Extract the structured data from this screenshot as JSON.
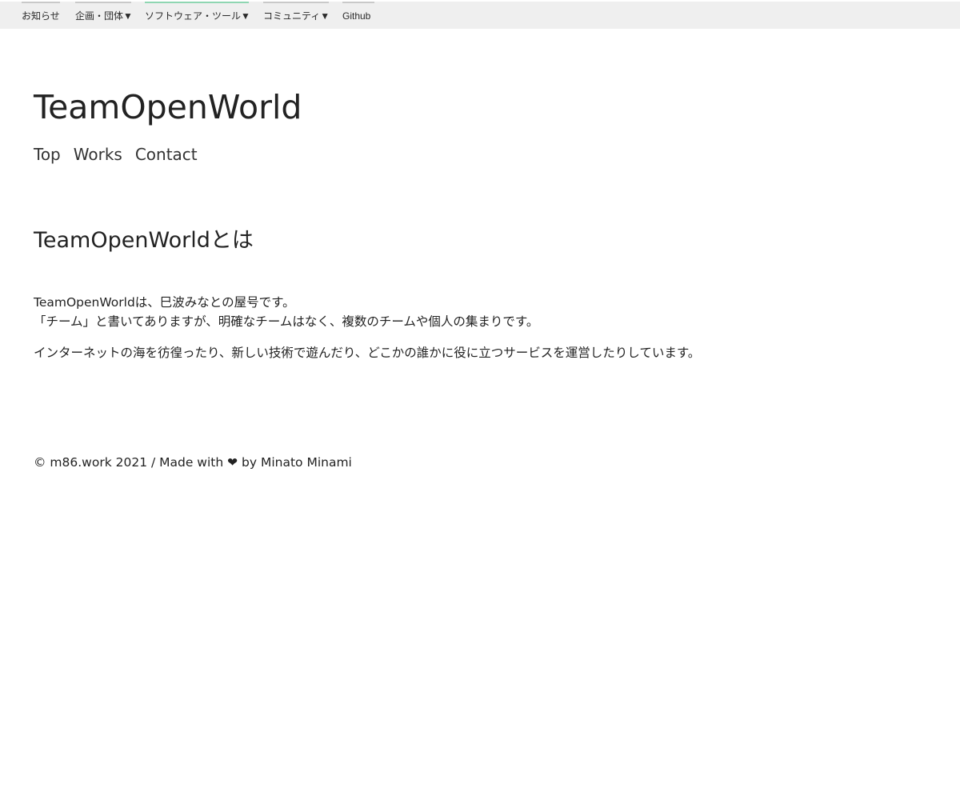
{
  "topbar": {
    "items": [
      {
        "label": "お知らせ"
      },
      {
        "label": "企画・団体▼"
      },
      {
        "label": "ソフトウェア・ツール▼"
      },
      {
        "label": "コミュニティ▼"
      },
      {
        "label": "Github"
      }
    ],
    "background": "#efefef",
    "accent": "#8fd6b2"
  },
  "header": {
    "title": "TeamOpenWorld",
    "nav": [
      "Top",
      "Works",
      "Contact"
    ]
  },
  "main": {
    "heading": "TeamOpenWorldとは",
    "paragraph1": {
      "line1": "TeamOpenWorldは、巳波みなとの屋号です。",
      "line2": "「チーム」と書いてありますが、明確なチームはなく、複数のチームや個人の集まりです。"
    },
    "paragraph2": "インターネットの海を彷徨ったり、新しい技術で遊んだり、どこかの誰かに役に立つサービスを運営したりしています。"
  },
  "footer": {
    "text": "© m86.work 2021 / Made with ❤ by Minato Minami"
  }
}
